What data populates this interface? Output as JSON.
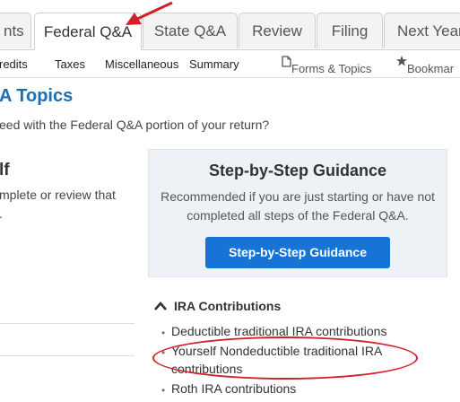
{
  "tabs": [
    {
      "label": "nts"
    },
    {
      "label": "Federal Q&A"
    },
    {
      "label": "State Q&A"
    },
    {
      "label": "Review"
    },
    {
      "label": "Filing"
    },
    {
      "label": "Next Year"
    }
  ],
  "subnav": {
    "items": [
      "redits",
      "Taxes",
      "Miscellaneous",
      "Summary"
    ],
    "forms_topics": "Forms & Topics",
    "bookmark": "Bookmar"
  },
  "page": {
    "title": "A Topics",
    "question": "eed with the Federal Q&A portion of your return?"
  },
  "left_panel": {
    "heading": "lf",
    "text_line1": "mplete or review that",
    "text_line2": "."
  },
  "guidance": {
    "title": "Step-by-Step Guidance",
    "desc_line1": "Recommended if you are just starting or have not",
    "desc_line2": "completed all steps of the Federal Q&A.",
    "button": "Step-by-Step Guidance"
  },
  "ira": {
    "heading": "IRA Contributions",
    "items": [
      {
        "label": "Deductible traditional IRA contributions"
      },
      {
        "label": "Yourself Nondeductible traditional IRA contributions"
      },
      {
        "label": "Roth IRA contributions"
      }
    ]
  },
  "colors": {
    "accent": "#1773d6",
    "title": "#1a6fb5",
    "annotation": "#d0202a"
  },
  "icons": [
    "document-icon",
    "bookmark-icon",
    "caret-up-icon",
    "arrow-annotation-icon",
    "bullet-icon"
  ]
}
